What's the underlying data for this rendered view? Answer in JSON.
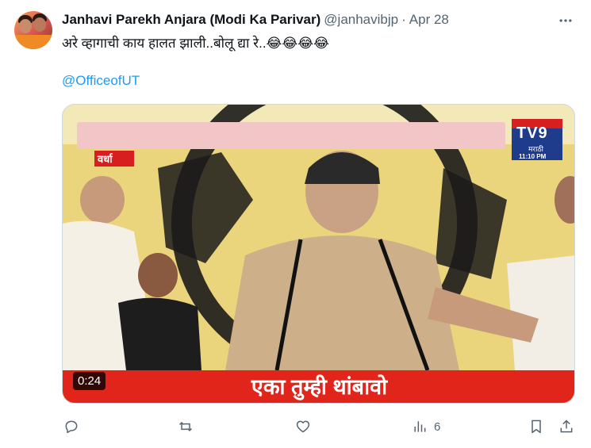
{
  "tweet": {
    "author_name": "Janhavi Parekh Anjara (Modi Ka Parivar)",
    "handle": "@janhavibjp",
    "separator": "·",
    "date": "Apr 28",
    "text": "अरे व्हागाची काय हालत झाली..बोलू द्या रे..😂😂😂😂",
    "mention": "@OfficeofUT"
  },
  "video": {
    "location_tag": "वर्धा",
    "channel_logo": "TV9",
    "channel_sub": "मराठी",
    "channel_time": "11:10 PM",
    "caption": "एका तुम्ही थांबावो",
    "duration": "0:24"
  },
  "actions": {
    "reply_icon": "reply-icon",
    "retweet_icon": "retweet-icon",
    "like_icon": "heart-icon",
    "views_icon": "views-chart-icon",
    "views_count": "6",
    "bookmark_icon": "bookmark-icon",
    "share_icon": "share-icon"
  },
  "colors": {
    "link": "#1d9bf0",
    "muted": "#536471",
    "caption_bar": "#e1251b"
  }
}
